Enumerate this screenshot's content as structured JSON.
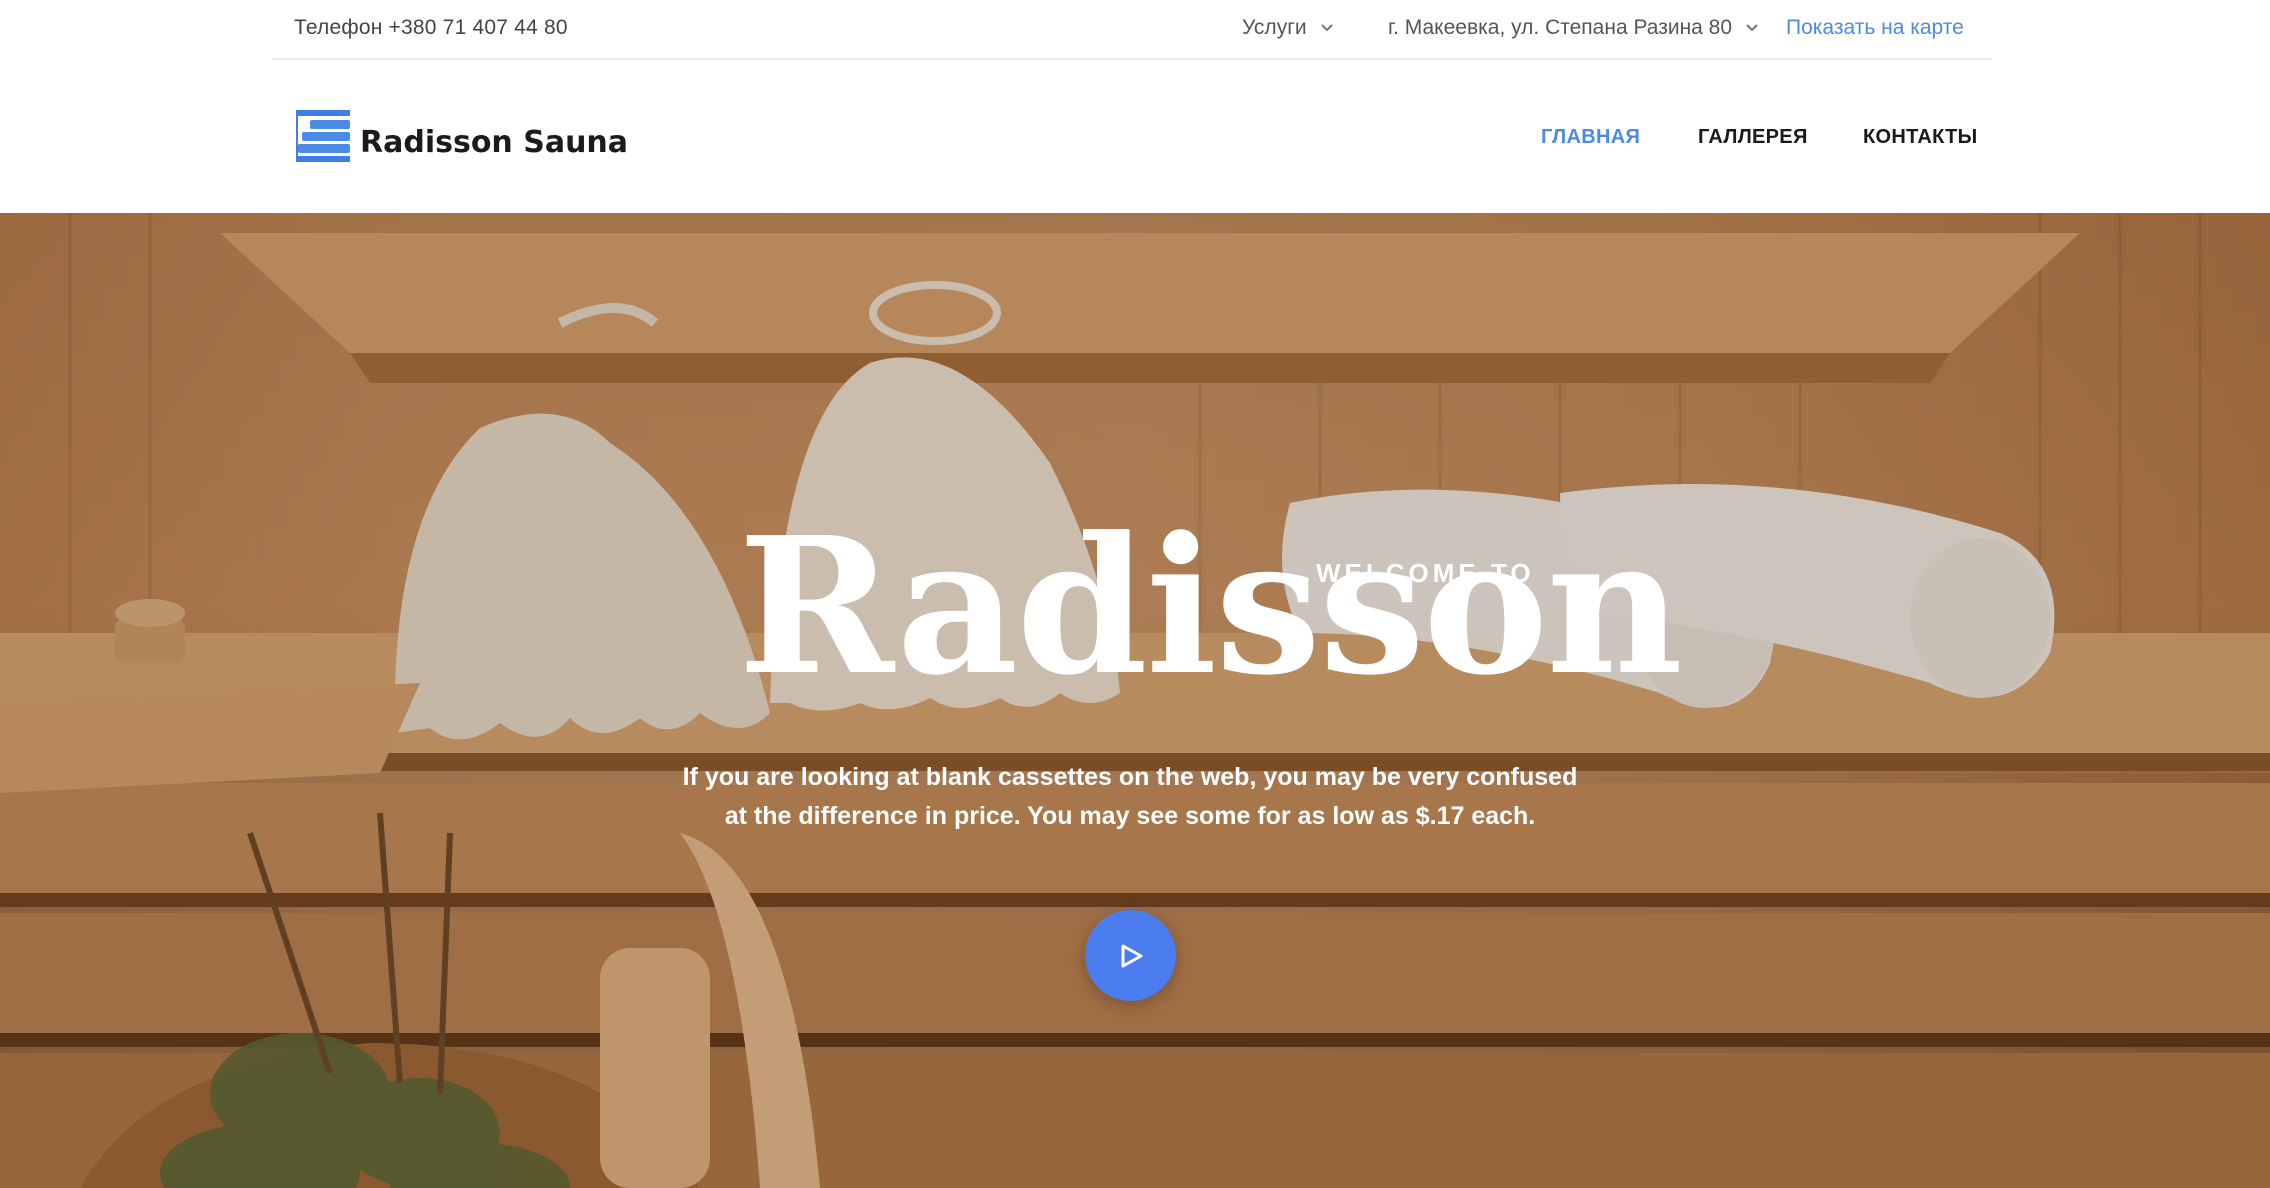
{
  "topbar": {
    "phone": "Телефон +380 71 407 44 80",
    "services_label": "Услуги",
    "address": "г. Макеевка, ул. Степана Разина 80",
    "map_link": "Показать на карте"
  },
  "header": {
    "logo_text": "Radisson Sauna",
    "nav": {
      "home": "ГЛАВНАЯ",
      "gallery": "ГАЛЛЕРЕЯ",
      "contacts": "КОНТАКТЫ"
    }
  },
  "hero": {
    "welcome": "WELCOME TO",
    "brand": "Radisson",
    "description": "If you are looking at blank cassettes on the web, you may be very confused at the difference in price. You may see some for as low as $.17 each.",
    "play_icon": "play-icon"
  },
  "colors": {
    "accent": "#4b8be6",
    "play_button": "#4b7df0",
    "text_dark": "#1a1a1a"
  }
}
